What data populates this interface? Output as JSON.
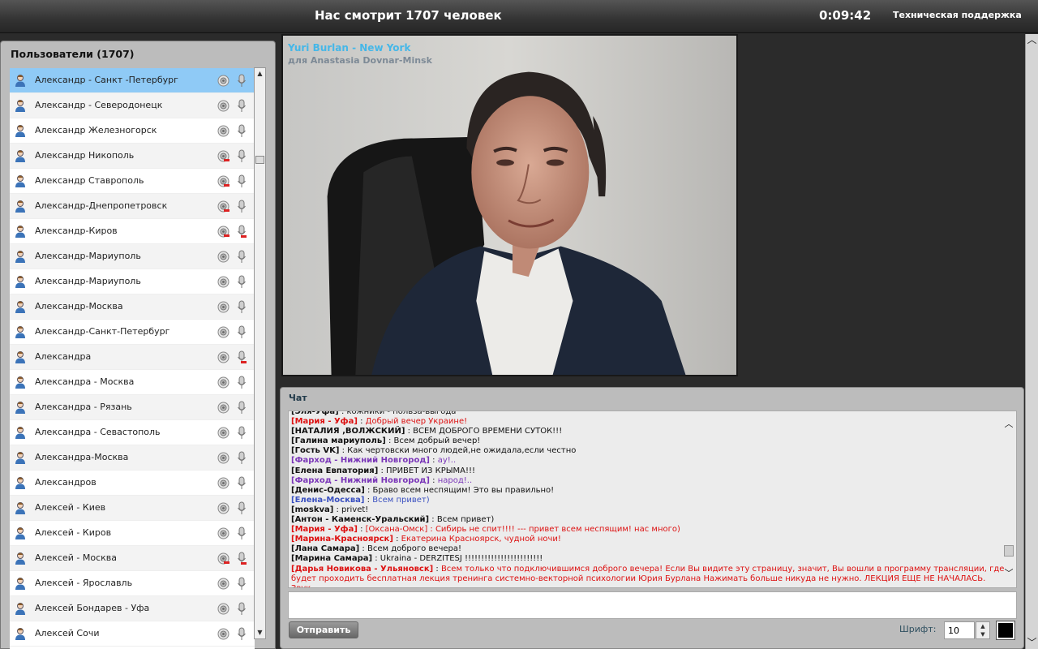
{
  "header": {
    "viewers_text": "Нас смотрит 1707 человек",
    "timer": "0:09:42",
    "support_link": "Техническая поддержка"
  },
  "users_panel": {
    "title": "Пользователи (1707)",
    "users": [
      {
        "name": "Александр - Санкт -Петербург",
        "cam": "on",
        "mic": "on",
        "selected": true
      },
      {
        "name": "Александр - Северодонецк",
        "cam": "on",
        "mic": "on"
      },
      {
        "name": "Александр Железногорск",
        "cam": "on",
        "mic": "on"
      },
      {
        "name": "Александр Никополь",
        "cam": "off",
        "mic": "on"
      },
      {
        "name": "Александр Ставрополь",
        "cam": "off",
        "mic": "on"
      },
      {
        "name": "Александр-Днепропетровск",
        "cam": "off",
        "mic": "on"
      },
      {
        "name": "Александр-Киров",
        "cam": "off",
        "mic": "off"
      },
      {
        "name": "Александр-Мариуполь",
        "cam": "on",
        "mic": "on"
      },
      {
        "name": "Александр-Мариуполь",
        "cam": "on",
        "mic": "on"
      },
      {
        "name": "Александр-Москва",
        "cam": "on",
        "mic": "on"
      },
      {
        "name": "Александр-Санкт-Петербург",
        "cam": "on",
        "mic": "on"
      },
      {
        "name": "Александра",
        "cam": "on",
        "mic": "off"
      },
      {
        "name": "Александра - Москва",
        "cam": "on",
        "mic": "on"
      },
      {
        "name": "Александра - Рязань",
        "cam": "on",
        "mic": "on"
      },
      {
        "name": "Александра - Севастополь",
        "cam": "on",
        "mic": "on"
      },
      {
        "name": "Александра-Москва",
        "cam": "on",
        "mic": "on"
      },
      {
        "name": "Александров",
        "cam": "on",
        "mic": "on"
      },
      {
        "name": "Алексей - Киев",
        "cam": "on",
        "mic": "on"
      },
      {
        "name": "Алексей - Киров",
        "cam": "on",
        "mic": "on"
      },
      {
        "name": "Алексей - Москва",
        "cam": "off",
        "mic": "off"
      },
      {
        "name": "Алексей - Ярославль",
        "cam": "on",
        "mic": "on"
      },
      {
        "name": "Алексей Бондарев - Уфа",
        "cam": "on",
        "mic": "on"
      },
      {
        "name": "Алексей Сочи",
        "cam": "on",
        "mic": "on"
      }
    ]
  },
  "scrollbar_glyphs": {
    "up": "▲",
    "down": "▼",
    "up_chevron": "︿",
    "down_chevron": "﹀"
  },
  "video": {
    "caption_line1": "Yuri Burlan - New York",
    "caption_line2": "для Anastasia Dovnar-Minsk"
  },
  "chat": {
    "title": "Чат",
    "messages": [
      {
        "nick": "[Эля-Уфа]",
        "text": "кожники - польза-выгода",
        "color": "black"
      },
      {
        "nick": "[Мария - Уфа]",
        "text": "Добрый вечер Украине!",
        "color": "red"
      },
      {
        "nick": "[НАТАЛИЯ ,ВОЛЖСКИЙ]",
        "text": "ВСЕМ ДОБРОГО ВРЕМЕНИ СУТОК!!!",
        "color": "black"
      },
      {
        "nick": "[Галина мариуполь]",
        "text": "Всем добрый вечер!",
        "color": "black"
      },
      {
        "nick": "[Гость VK]",
        "text": "Как чертовски много людей,не ожидала,если честно",
        "color": "black"
      },
      {
        "nick": "[Фарход - Нижний Новгород]",
        "text": "ау!..",
        "color": "purple"
      },
      {
        "nick": "[Елена Евпатория]",
        "text": "ПРИВЕТ ИЗ КРЫМА!!!",
        "color": "black"
      },
      {
        "nick": "[Фарход - Нижний Новгород]",
        "text": "народ!..",
        "color": "purple"
      },
      {
        "nick": "[Денис-Одесса]",
        "text": "Браво всем неспящим! Это вы правильно!",
        "color": "black"
      },
      {
        "nick": "[Елена-Москва]",
        "text": "Всем привет)",
        "color": "blue"
      },
      {
        "nick": "[moskva]",
        "text": "privet!",
        "color": "black"
      },
      {
        "nick": "[Антон - Каменск-Уральский]",
        "text": "Всем привет)",
        "color": "black"
      },
      {
        "nick": "[Мария - Уфа]",
        "text": "[Оксана-Омск] : Сибирь не спит!!!! --- привет всем неспящим! нас много)",
        "color": "red"
      },
      {
        "nick": "[Марина-Красноярск]",
        "text": "Екатерина Красноярск, чудной ночи!",
        "color": "red"
      },
      {
        "nick": "[Лана Самара]",
        "text": "Всем доброго вечера!",
        "color": "black"
      },
      {
        "nick": "[Марина Самара]",
        "text": "Ukraina - DERZITESJ !!!!!!!!!!!!!!!!!!!!!!!!",
        "color": "black"
      },
      {
        "nick": "[Дарья Новикова - Ульяновск]",
        "text": "Всем только что подключившимся доброго вечера! Если Вы видите эту страницу, значит, Вы вошли в программу трансляции, где будет проходить бесплатная лекция тренинга системно-векторной психологии Юрия Бурлана Нажимать больше никуда не нужно. ЛЕКЦИЯ ЕЩЕ НЕ НАЧАЛАСЬ. Звук",
        "color": "red"
      }
    ],
    "input_value": "",
    "send_label": "Отправить",
    "font_label": "Шрифт:",
    "font_size": "10",
    "text_color": "#000000"
  }
}
